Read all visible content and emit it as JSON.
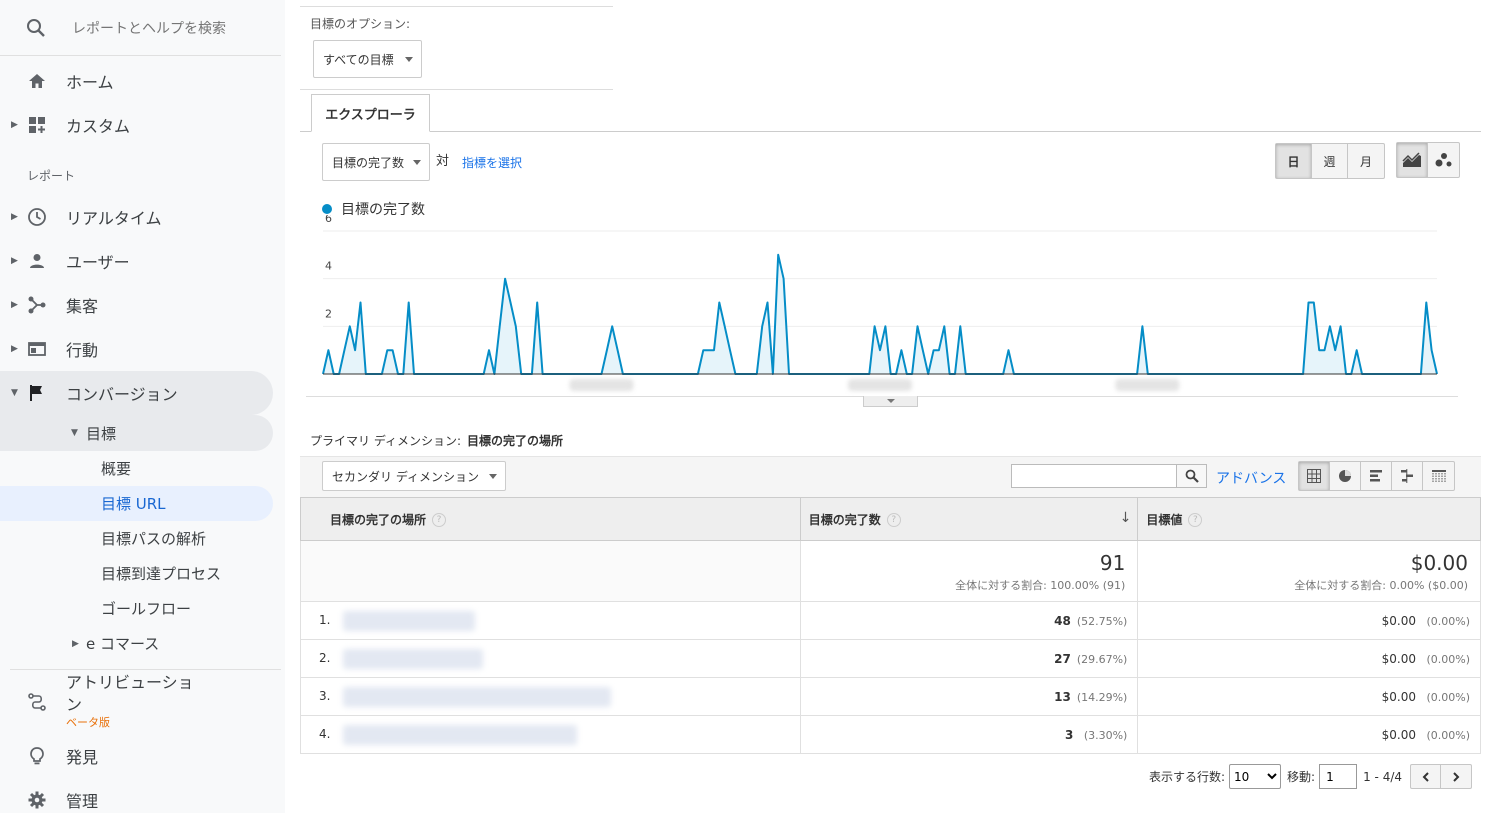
{
  "sidebar": {
    "search_placeholder": "レポートとヘルプを検索",
    "home": "ホーム",
    "custom": "カスタム",
    "section_reports": "レポート",
    "realtime": "リアルタイム",
    "audience": "ユーザー",
    "acquisition": "集客",
    "behavior": "行動",
    "conversions": "コンバージョン",
    "goals": "目標",
    "goal_items": [
      "概要",
      "目標 URL",
      "目標パスの解析",
      "目標到達プロセス",
      "ゴールフロー"
    ],
    "ecommerce": "e コマース",
    "attribution": "アトリビューション",
    "beta": "ベータ版",
    "discover": "発見",
    "admin": "管理"
  },
  "goal_options": {
    "title": "目標のオプション:",
    "selected": "すべての目標"
  },
  "explorer": {
    "tab": "エクスプローラ",
    "metric_selected": "目標の完了数",
    "vs": "対",
    "select_metric": "指標を選択",
    "periods": [
      "日",
      "週",
      "月"
    ],
    "active_period": "日"
  },
  "chart_data": {
    "type": "area",
    "series": [
      {
        "name": "目標の完了数",
        "values": [
          0,
          1,
          0,
          0,
          1,
          2,
          1,
          3,
          0,
          0,
          0,
          0,
          1,
          1,
          0,
          0,
          3,
          0,
          0,
          0,
          0,
          0,
          0,
          0,
          0,
          0,
          0,
          0,
          0,
          0,
          0,
          1,
          0,
          2,
          4,
          3,
          2,
          0,
          0,
          0,
          3,
          0,
          0,
          0,
          0,
          0,
          0,
          0,
          0,
          0,
          0,
          0,
          0,
          1,
          2,
          1,
          0,
          0,
          0,
          0,
          0,
          0,
          0,
          0,
          0,
          0,
          0,
          0,
          0,
          0,
          0,
          1,
          1,
          1,
          3,
          2,
          1,
          0,
          0,
          0,
          0,
          0,
          2,
          3,
          0,
          5,
          4,
          0,
          0,
          0,
          0,
          0,
          0,
          0,
          0,
          0,
          0,
          0,
          0,
          0,
          0,
          0,
          0,
          2,
          1,
          2,
          0,
          0,
          1,
          0,
          0,
          2,
          1,
          0,
          1,
          1,
          2,
          0,
          0,
          2,
          0,
          0,
          0,
          0,
          0,
          0,
          0,
          0,
          1,
          0,
          0,
          0,
          0,
          0,
          0,
          0,
          0,
          0,
          0,
          0,
          0,
          0,
          0,
          0,
          0,
          0,
          0,
          0,
          0,
          0,
          0,
          0,
          0,
          2,
          0,
          0,
          0,
          0,
          0,
          0,
          0,
          0,
          0,
          0,
          0,
          0,
          0,
          0,
          0,
          0,
          0,
          0,
          0,
          0,
          0,
          0,
          0,
          0,
          0,
          0,
          0,
          0,
          0,
          0,
          3,
          3,
          1,
          1,
          2,
          1,
          2,
          0,
          0,
          1,
          0,
          0,
          0,
          0,
          0,
          0,
          0,
          0,
          0,
          0,
          0,
          0,
          3,
          1,
          0
        ]
      }
    ],
    "yticks": [
      2,
      4,
      6
    ],
    "ylim": [
      0,
      6
    ],
    "grid": true,
    "series_color": "#058dc7"
  },
  "report": {
    "primary_dimension_label": "プライマリ ディメンション:",
    "primary_dimension_value": "目標の完了の場所",
    "secondary_dimension": "セカンダリ ディメンション",
    "advanced": "アドバンス",
    "columns": [
      "目標の完了の場所",
      "目標の完了数",
      "目標値"
    ],
    "totals": {
      "completions": "91",
      "completions_sub": "全体に対する割合: 100.00% (91)",
      "value": "$0.00",
      "value_sub": "全体に対する割合: 0.00% ($0.00)"
    },
    "rows": [
      {
        "index": "1.",
        "completions": "48",
        "completions_pct": "(52.75%)",
        "value": "$0.00",
        "value_pct": "(0.00%)"
      },
      {
        "index": "2.",
        "completions": "27",
        "completions_pct": "(29.67%)",
        "value": "$0.00",
        "value_pct": "(0.00%)"
      },
      {
        "index": "3.",
        "completions": "13",
        "completions_pct": "(14.29%)",
        "value": "$0.00",
        "value_pct": "(0.00%)"
      },
      {
        "index": "4.",
        "completions": "3",
        "completions_pct": "(3.30%)",
        "value": "$0.00",
        "value_pct": "(0.00%)"
      }
    ]
  },
  "pager": {
    "rows_label": "表示する行数:",
    "rows_value": "10",
    "goto_label": "移動:",
    "goto_value": "1",
    "range": "1 - 4/4"
  },
  "colors": {
    "accent": "#1a73e8",
    "chart_line": "#058dc7",
    "chart_fill": "#e6f4fa",
    "beta": "#e8710a"
  }
}
